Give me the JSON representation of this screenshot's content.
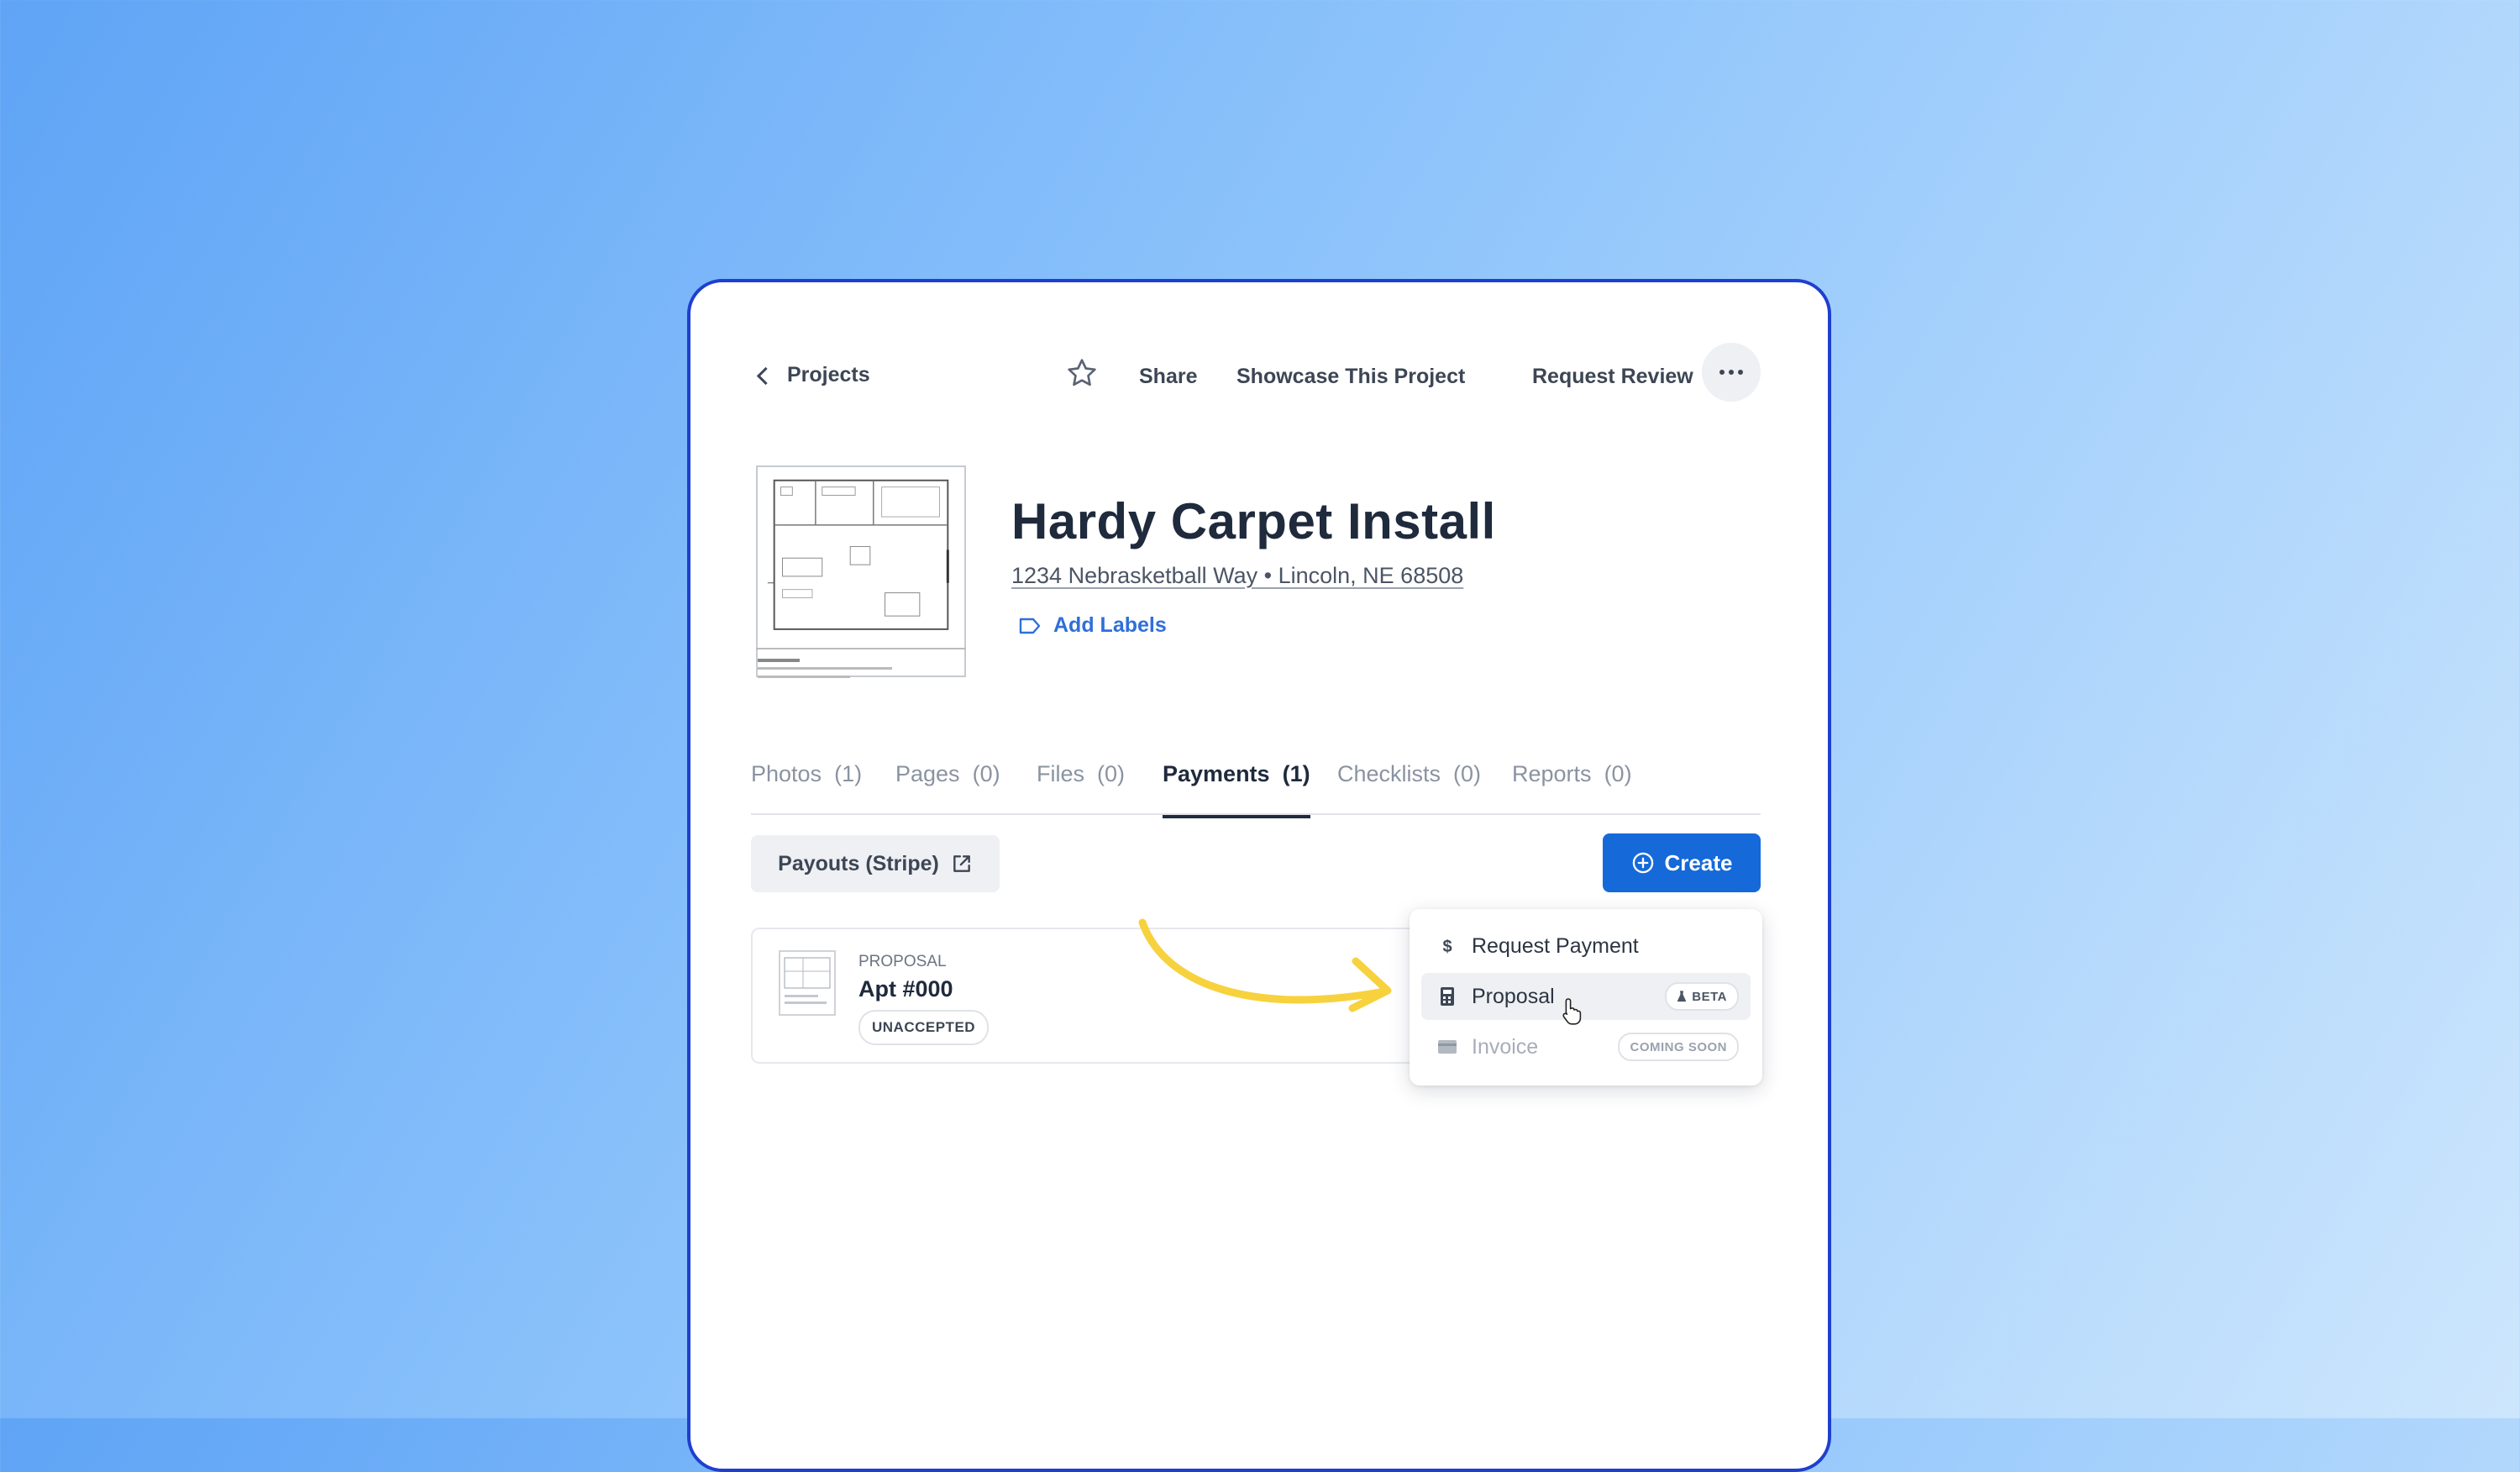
{
  "header": {
    "back_label": "Projects",
    "share_label": "Share",
    "showcase_label": "Showcase This Project",
    "review_label": "Request Review"
  },
  "project": {
    "title": "Hardy Carpet Install",
    "address": "1234 Nebrasketball Way • Lincoln, NE 68508",
    "add_labels": "Add Labels"
  },
  "tabs": [
    {
      "label": "Photos",
      "count": "(1)"
    },
    {
      "label": "Pages",
      "count": "(0)"
    },
    {
      "label": "Files",
      "count": "(0)"
    },
    {
      "label": "Payments",
      "count": "(1)"
    },
    {
      "label": "Checklists",
      "count": "(0)"
    },
    {
      "label": "Reports",
      "count": "(0)"
    }
  ],
  "active_tab": "Payments",
  "payments": {
    "payouts_label": "Payouts (Stripe)",
    "create_label": "Create",
    "items": [
      {
        "kind": "PROPOSAL",
        "title": "Apt #000",
        "status": "UNACCEPTED"
      }
    ]
  },
  "create_menu": {
    "items": [
      {
        "label": "Request Payment",
        "icon": "dollar-icon"
      },
      {
        "label": "Proposal",
        "icon": "calculator-icon",
        "badge": "BETA"
      },
      {
        "label": "Invoice",
        "icon": "card-icon",
        "badge": "COMING SOON"
      }
    ]
  },
  "colors": {
    "accent": "#1569d9",
    "link": "#2f6fd8",
    "card_border": "#1e3fcf",
    "annotation_arrow": "#f7d23e"
  }
}
